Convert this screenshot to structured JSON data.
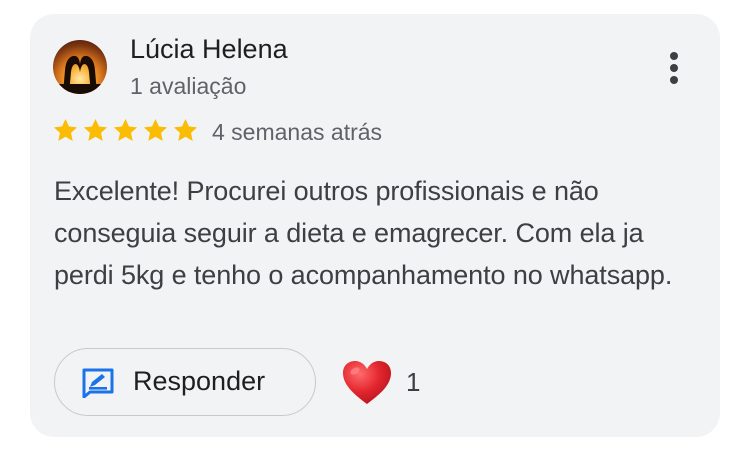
{
  "review": {
    "author": "Lúcia Helena",
    "author_meta": "1 avaliação",
    "rating": 5,
    "max_rating": 5,
    "date": "4 semanas atrás",
    "text": "Excelente! Procurei outros profissionais e não conseguia seguir a dieta e emagrecer. Com ela ja perdi 5kg e tenho o acompanhamento no whatsapp.",
    "reply_label": "Responder",
    "reaction_icon": "heart-icon",
    "reaction_count": "1"
  },
  "colors": {
    "card_background": "#f2f3f5",
    "star": "#fbbc04",
    "reply_icon": "#1a73e8",
    "heart": "#e3262f",
    "text_primary": "#1f1f1f",
    "text_secondary": "#5f6368"
  },
  "icons": [
    "avatar",
    "more-options-icon",
    "star-icon",
    "reply-icon",
    "heart-icon"
  ]
}
